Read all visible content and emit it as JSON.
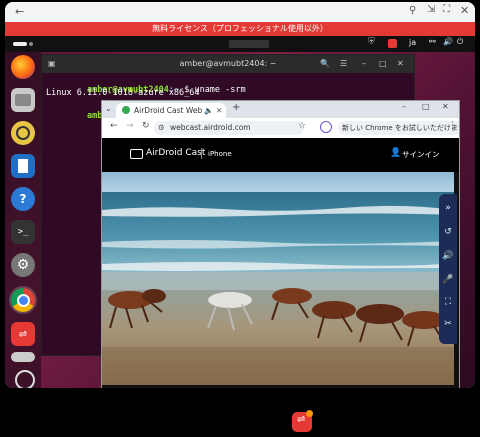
{
  "remote_window": {
    "back_icon": "arrow-left-icon",
    "controls": [
      "pin-icon",
      "minimize-to-corner-icon",
      "fullscreen-icon",
      "close-icon"
    ]
  },
  "license_banner": "無料ライセンス（プロフェッショナル使用以外）",
  "ubuntu_topbar": {
    "lang": "ja",
    "icons": [
      "shield-icon",
      "airdroid-icon",
      "network-icon",
      "volume-icon",
      "power-icon"
    ]
  },
  "dock": {
    "items": [
      "firefox-icon",
      "files-icon",
      "rhythmbox-icon",
      "writer-icon",
      "help-icon",
      "terminal-icon",
      "settings-icon",
      "chrome-icon",
      "airdroid-cast-icon",
      "trash-icon",
      "apps-grid-icon"
    ]
  },
  "terminal": {
    "title": "amber@avmubt2404: ~",
    "line1_prompt": "amber@avmubt2404",
    "line1_path": ":~",
    "line1_cmd": "$ uname -srm",
    "line2": "Linux 6.11.0-1018-azure x86_64",
    "line3_prompt": "amber@avmubt2404",
    "line3_path": ":~"
  },
  "chrome": {
    "tab_title": "AirDroid Cast Web",
    "url": "webcast.airdroid.com",
    "sign_in_notice": "新しい Chrome をお試しいただけます"
  },
  "airdroid_cast": {
    "logo": "AirDroid Cast",
    "device": "iPhone",
    "signin": "サインイン"
  },
  "colors": {
    "license_red": "#e53935",
    "terminal_bg": "#300a24",
    "prompt_green": "#8ae234",
    "path_blue": "#729fcf",
    "side_panel": "#1d2b57"
  }
}
